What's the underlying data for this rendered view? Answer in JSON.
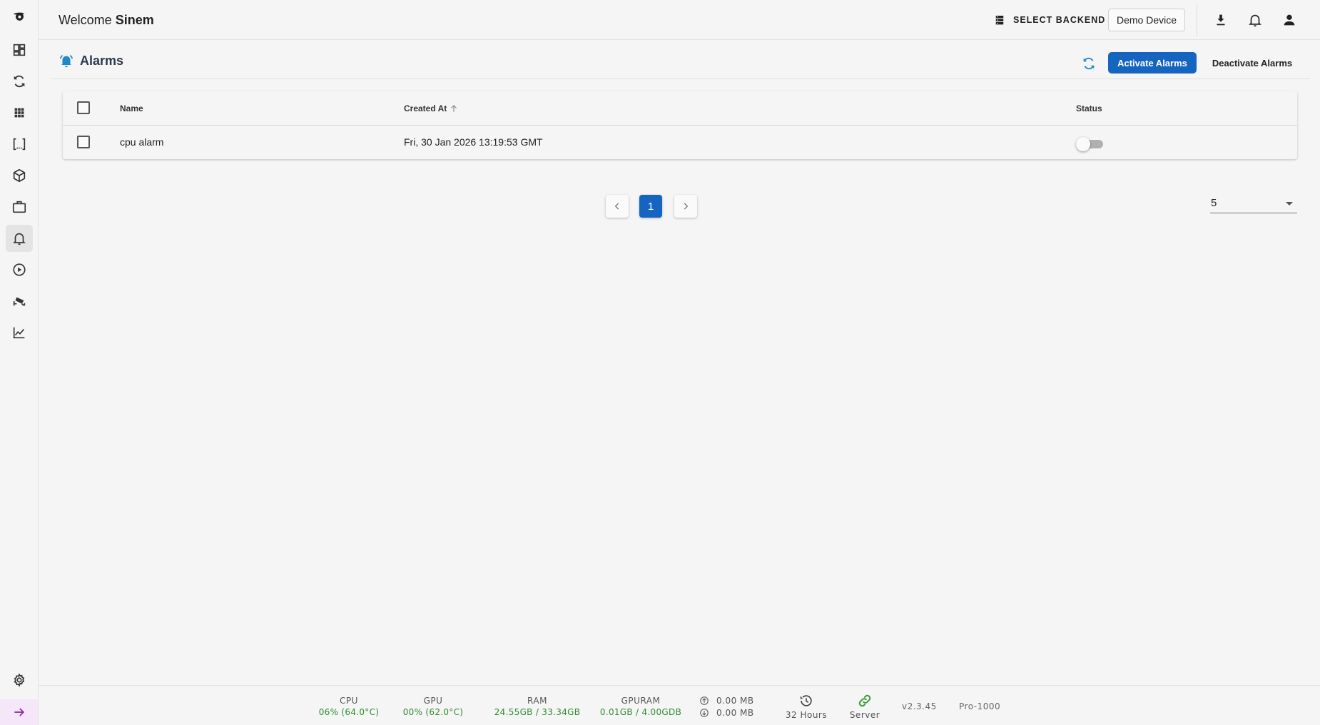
{
  "header": {
    "welcome_prefix": "Welcome",
    "user_name": "Sinem",
    "select_backend_label": "SELECT BACKEND",
    "device_label": "Demo Device"
  },
  "sidebar": {
    "items": [
      {
        "icon": "dashboard-icon"
      },
      {
        "icon": "sync-icon"
      },
      {
        "icon": "apps-grid-icon"
      },
      {
        "icon": "brackets-icon"
      },
      {
        "icon": "cube-icon"
      },
      {
        "icon": "briefcase-icon"
      },
      {
        "icon": "bell-icon",
        "active": true
      },
      {
        "icon": "play-circle-icon"
      },
      {
        "icon": "cctv-camera-icon"
      },
      {
        "icon": "chart-line-icon"
      }
    ],
    "settings_icon": "gear-icon",
    "expand_icon": "arrow-right-icon"
  },
  "page": {
    "title": "Alarms",
    "activate_label": "Activate Alarms",
    "deactivate_label": "Deactivate Alarms"
  },
  "table": {
    "columns": {
      "name": "Name",
      "created_at": "Created At",
      "status": "Status"
    },
    "rows": [
      {
        "name": "cpu alarm",
        "created_at": "Fri, 30 Jan 2026 13:19:53 GMT",
        "status_on": false
      }
    ]
  },
  "pagination": {
    "current_page": "1",
    "page_size": "5"
  },
  "footer": {
    "cpu_label": "CPU",
    "cpu_value": "06% (64.0°C)",
    "gpu_label": "GPU",
    "gpu_value": "00% (62.0°C)",
    "ram_label": "RAM",
    "ram_value": "24.55GB / 33.34GB",
    "gpuram_label": "GPURAM",
    "gpuram_value": "0.01GB / 4.00GDB",
    "net_up": "0.00 MB",
    "net_down": "0.00 MB",
    "uptime": "32 Hours",
    "server_label": "Server",
    "version": "v2.3.45",
    "plan": "Pro-1000"
  },
  "colors": {
    "primary": "#1565c0",
    "accent_icon": "#1e88c8",
    "status_green": "#2e8b2e",
    "expand_bg": "#f6e6fa",
    "expand_arrow": "#8e24aa"
  }
}
